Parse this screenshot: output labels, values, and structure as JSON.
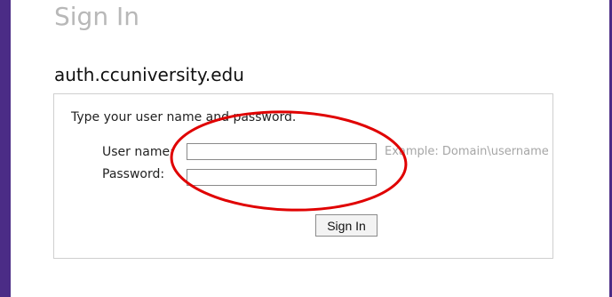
{
  "header": {
    "title": "Sign In",
    "domain": "auth.ccuniversity.edu"
  },
  "form": {
    "instruction": "Type your user name and password.",
    "username_label": "User name:",
    "username_value": "",
    "username_hint": "Example: Domain\\username",
    "password_label": "Password:",
    "password_value": "",
    "submit_label": "Sign In"
  },
  "colors": {
    "frame": "#4b2c86",
    "annotation_circle": "#e00000"
  }
}
